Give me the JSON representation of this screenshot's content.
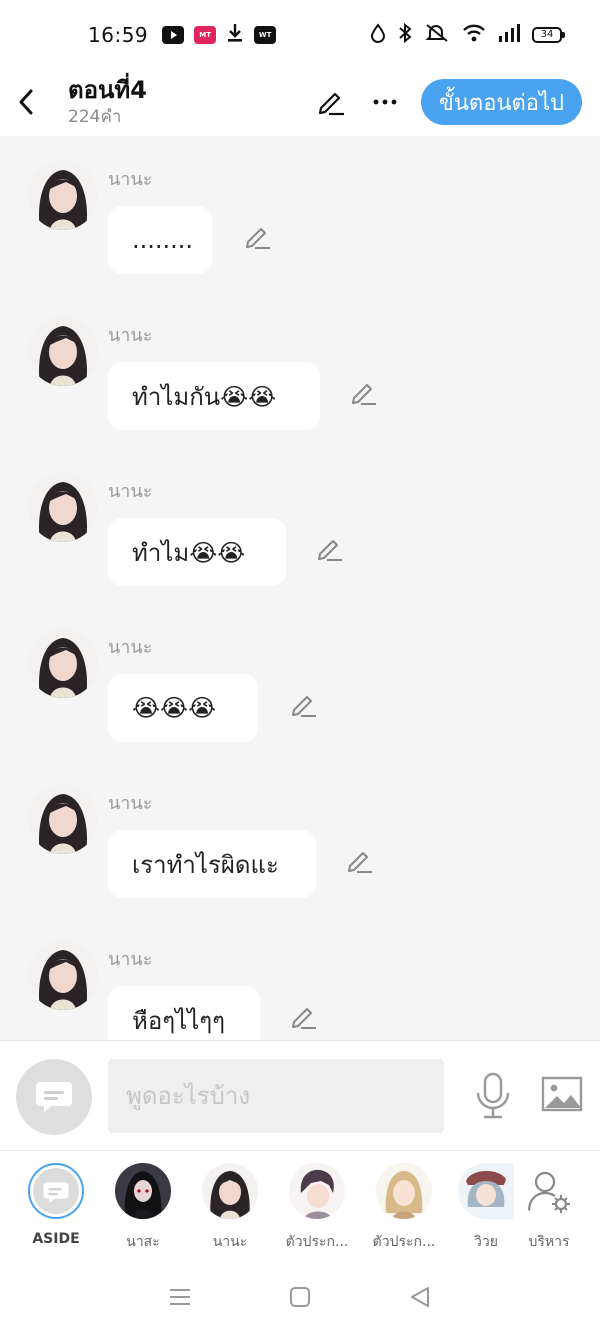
{
  "status_bar": {
    "time": "16:59",
    "apps": [
      {
        "name": "youtube-icon",
        "color": "#111111",
        "text": "▶"
      },
      {
        "name": "mangatoon-icon",
        "color": "#e0245e",
        "text": "MANGA TOON"
      },
      {
        "name": "download-icon",
        "color": "#111111",
        "text": "⬇"
      },
      {
        "name": "webtoon-icon",
        "color": "#111111",
        "text": "WEB TOON"
      }
    ],
    "battery": "34"
  },
  "header": {
    "title": "ตอนที่4",
    "word_count": "224คำ",
    "next_label": "ขั้นตอนต่อไป"
  },
  "messages": [
    {
      "sender": "นานะ",
      "text": "........"
    },
    {
      "sender": "นานะ",
      "text": "ทำไมกัน😭😭"
    },
    {
      "sender": "นานะ",
      "text": "ทำไม😭😭"
    },
    {
      "sender": "นานะ",
      "text": "😭😭😭"
    },
    {
      "sender": "นานะ",
      "text": "เราทำไรผิดแะ"
    },
    {
      "sender": "นานะ",
      "text": "หือๆไไๆๆ"
    }
  ],
  "composer": {
    "placeholder": "พูดอะไรบ้าง"
  },
  "characters": [
    {
      "label": "ASIDE"
    },
    {
      "label": "นาสะ"
    },
    {
      "label": "นานะ"
    },
    {
      "label": "ตัวประก..."
    },
    {
      "label": "ตัวประก..."
    },
    {
      "label": "วิวย"
    },
    {
      "label": "บริหาร"
    }
  ],
  "colors": {
    "accent": "#4aa3f0",
    "chat_background": "#f5f5f5"
  }
}
